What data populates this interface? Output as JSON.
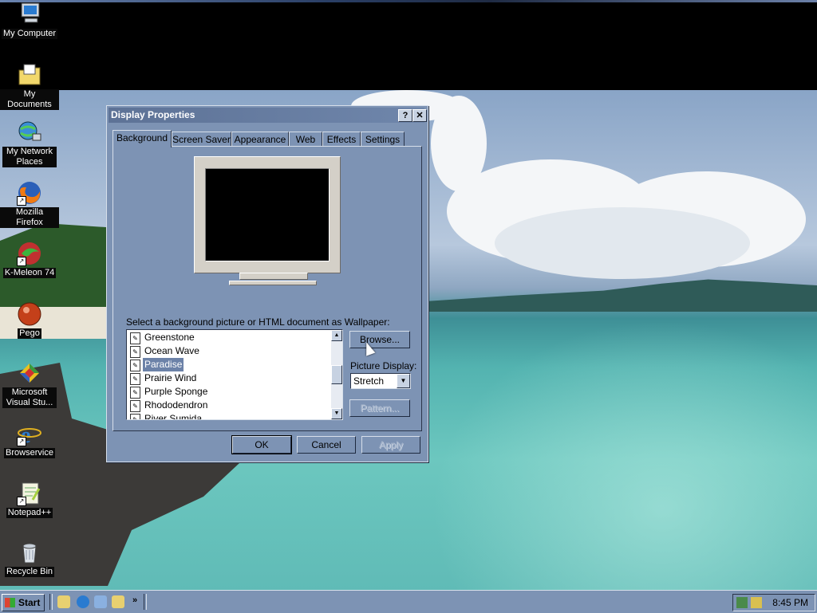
{
  "desktop": {
    "icons": [
      {
        "label": "My Computer",
        "icon": "computer-icon"
      },
      {
        "label": "My Documents",
        "icon": "folder-documents-icon"
      },
      {
        "label": "My Network Places",
        "icon": "network-places-icon"
      },
      {
        "label": "Mozilla Firefox",
        "icon": "firefox-icon"
      },
      {
        "label": "K-Meleon 74",
        "icon": "k-meleon-icon"
      },
      {
        "label": "Pego",
        "icon": "pego-icon"
      },
      {
        "label": "Microsoft Visual Stu...",
        "icon": "visual-studio-icon"
      },
      {
        "label": "Browservice",
        "icon": "internet-explorer-icon"
      },
      {
        "label": "Notepad++",
        "icon": "notepad-plus-plus-icon"
      },
      {
        "label": "Recycle Bin",
        "icon": "recycle-bin-icon"
      }
    ]
  },
  "dialog": {
    "title": "Display Properties",
    "help_button": "?",
    "close_button": "✕",
    "tabs": [
      "Background",
      "Screen Saver",
      "Appearance",
      "Web",
      "Effects",
      "Settings"
    ],
    "active_tab": "Background",
    "select_label": "Select a background picture or HTML document as Wallpaper:",
    "wallpapers": [
      "Greenstone",
      "Ocean Wave",
      "Paradise",
      "Prairie Wind",
      "Purple Sponge",
      "Rhododendron",
      "River Sumida"
    ],
    "selected_wallpaper": "Paradise",
    "browse_label": "Browse...",
    "picture_display_label": "Picture Display:",
    "picture_display_value": "Stretch",
    "pattern_label": "Pattern...",
    "ok_label": "OK",
    "cancel_label": "Cancel",
    "apply_label": "Apply"
  },
  "taskbar": {
    "start_label": "Start",
    "quick_launch": [
      "show-desktop-icon",
      "internet-explorer-icon",
      "outlook-express-icon",
      "explorer-icon"
    ],
    "more_label": "»",
    "clock": "8:45 PM",
    "tray_icons": [
      "network-tray-icon",
      "volume-tray-icon"
    ]
  },
  "colors": {
    "dialog_face": "#7d93b4",
    "title_bar": "#6f86ab",
    "selection": "#6c82a8"
  }
}
